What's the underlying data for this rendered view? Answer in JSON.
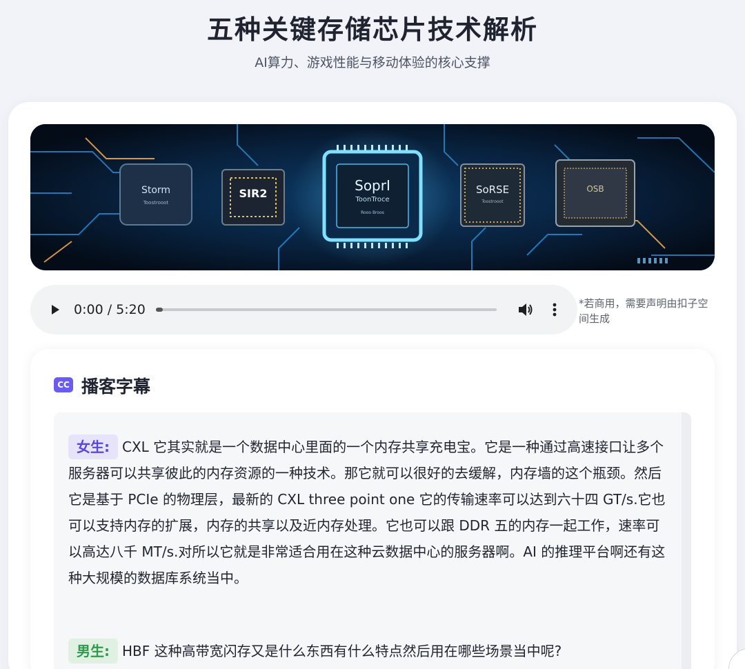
{
  "header": {
    "title": "五种关键存储芯片技术解析",
    "subtitle": "AI算力、游戏性能与移动体验的核心支撑"
  },
  "hero": {
    "chips": [
      "Storm",
      "SIR2",
      "SoprI",
      "SoRSE",
      "OSB"
    ],
    "chip_subtexts": [
      "Toostrooot",
      "ToonTroce",
      "Rooo Broos"
    ]
  },
  "audio_player": {
    "time_display": "0:00 / 5:20",
    "progress_fraction": 0.0,
    "play_icon": "play-icon",
    "volume_icon": "volume-icon",
    "menu_icon": "more-vertical-icon"
  },
  "notice": "*若商用，需要声明由扣子空间生成",
  "transcript_section": {
    "icon_label": "CC",
    "title": "播客字幕",
    "entries": [
      {
        "speaker": "女生:",
        "text": "CXL 它其实就是一个数据中心里面的一个内存共享充电宝。它是一种通过高速接口让多个服务器可以共享彼此的内存资源的一种技术。那它就可以很好的去缓解，内存墙的这个瓶颈。然后它是基于 PCIe 的物理层，最新的 CXL three point one 它的传输速率可以达到六十四 GT/s.它也可以支持内存的扩展，内存的共享以及近内存处理。它也可以跟 DDR 五的内存一起工作，速率可以高达八千 MT/s.对所以它就是非常适合用在这种云数据中心的服务器啊。AI 的推理平台啊还有这种大规模的数据库系统当中。"
      },
      {
        "speaker": "男生:",
        "text": "HBF 这种高带宽闪存又是什么东西有什么特点然后用在哪些场景当中呢?"
      }
    ]
  },
  "colors": {
    "accent": "#6a5cf0",
    "female_tag": "#5847d8",
    "male_tag": "#2f9a4b",
    "background": "#f1f3f8"
  }
}
